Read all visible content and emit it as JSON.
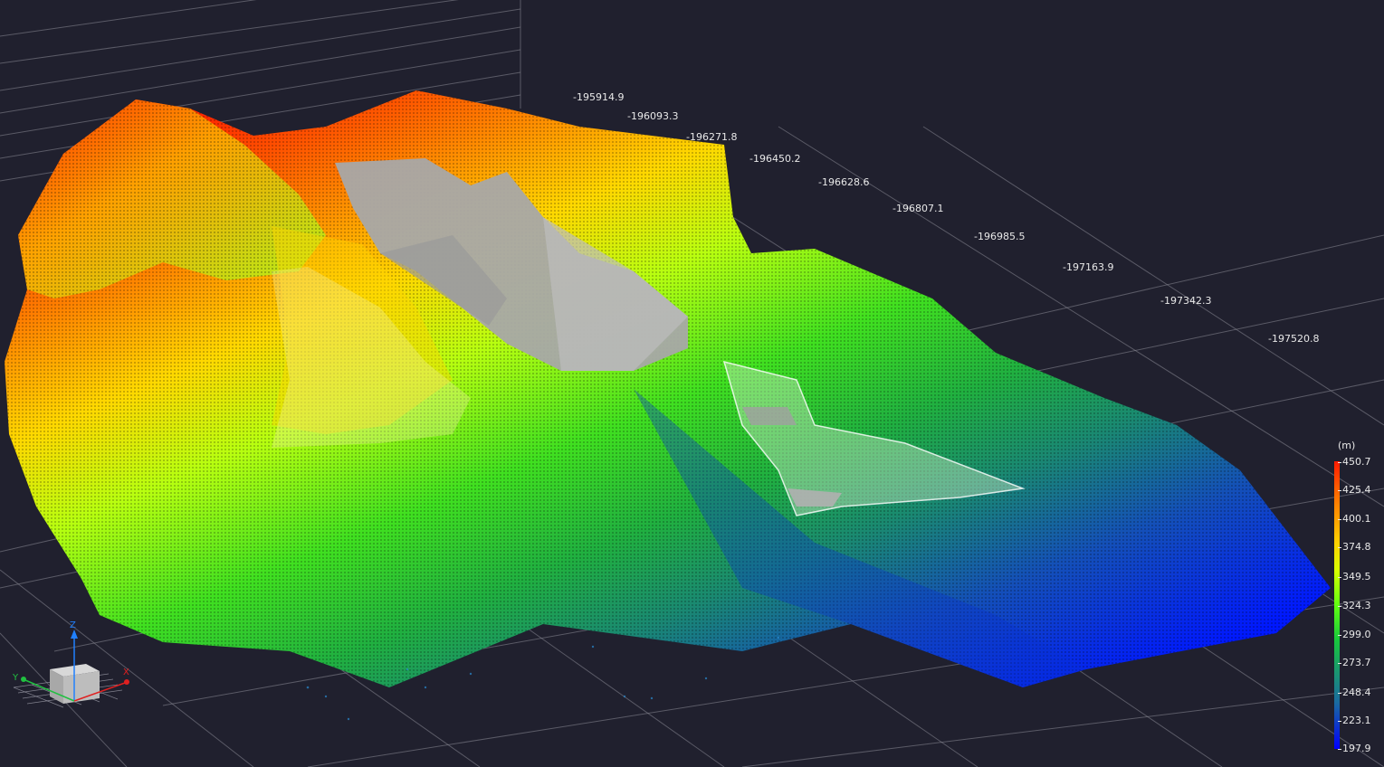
{
  "viewer": {
    "axis_labels": [
      "-195914.9",
      "-196093.3",
      "-196271.8",
      "-196450.2",
      "-196628.6",
      "-196807.1",
      "-196985.5",
      "-197163.9",
      "-197342.3",
      "-197520.8"
    ]
  },
  "scalar_bar": {
    "unit": "(m)",
    "ticks": [
      "450.7",
      "425.4",
      "400.1",
      "374.8",
      "349.5",
      "324.3",
      "299.0",
      "273.7",
      "248.4",
      "223.1",
      "197.9"
    ]
  },
  "orientation": {
    "x_label": "X",
    "y_label": "Y",
    "z_label": "Z",
    "x_color": "#e02020",
    "y_color": "#20c040",
    "z_color": "#2080ff"
  },
  "colors": {
    "background": "#20202e",
    "grid": "#8a8a96"
  }
}
